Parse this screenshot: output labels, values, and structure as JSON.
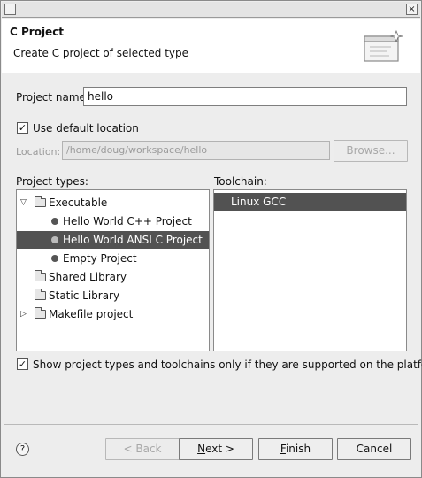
{
  "window": {
    "close_glyph": "×",
    "minimize_glyph": "_",
    "maximize_glyph": "□"
  },
  "header": {
    "title": "C Project",
    "description": "Create C project of selected type"
  },
  "project_name": {
    "label": "Project name:",
    "value": "hello"
  },
  "use_default_location": {
    "label": "Use default location",
    "checked": true,
    "check_glyph": "✓"
  },
  "location": {
    "label": "Location:",
    "value": "/home/doug/workspace/hello",
    "browse_label": "Browse..."
  },
  "project_types": {
    "label": "Project types:",
    "items": [
      {
        "label": "Executable",
        "icon": "folder-icon",
        "expanded": true,
        "twisty": "▽"
      },
      {
        "label": "Hello World C++ Project",
        "icon": "project-icon"
      },
      {
        "label": "Hello World ANSI C Project",
        "icon": "project-icon",
        "selected": true
      },
      {
        "label": "Empty Project",
        "icon": "project-icon"
      },
      {
        "label": "Shared Library",
        "icon": "folder-icon"
      },
      {
        "label": "Static Library",
        "icon": "folder-icon"
      },
      {
        "label": "Makefile project",
        "icon": "folder-icon",
        "expanded": false,
        "twisty": "▷"
      }
    ]
  },
  "toolchain": {
    "label": "Toolchain:",
    "items": [
      {
        "label": "Linux GCC",
        "selected": true
      }
    ]
  },
  "show_supported": {
    "label": "Show project types and toolchains only if they are supported on the platform",
    "checked": true,
    "check_glyph": "✓"
  },
  "buttons": {
    "help_glyph": "?",
    "back": "< Back",
    "next_prefix": "",
    "next_mnemonic": "N",
    "next_suffix": "ext >",
    "finish_mnemonic": "F",
    "finish_suffix": "inish",
    "cancel": "Cancel"
  },
  "colors": {
    "selection": "#525252",
    "background": "#ededed"
  }
}
